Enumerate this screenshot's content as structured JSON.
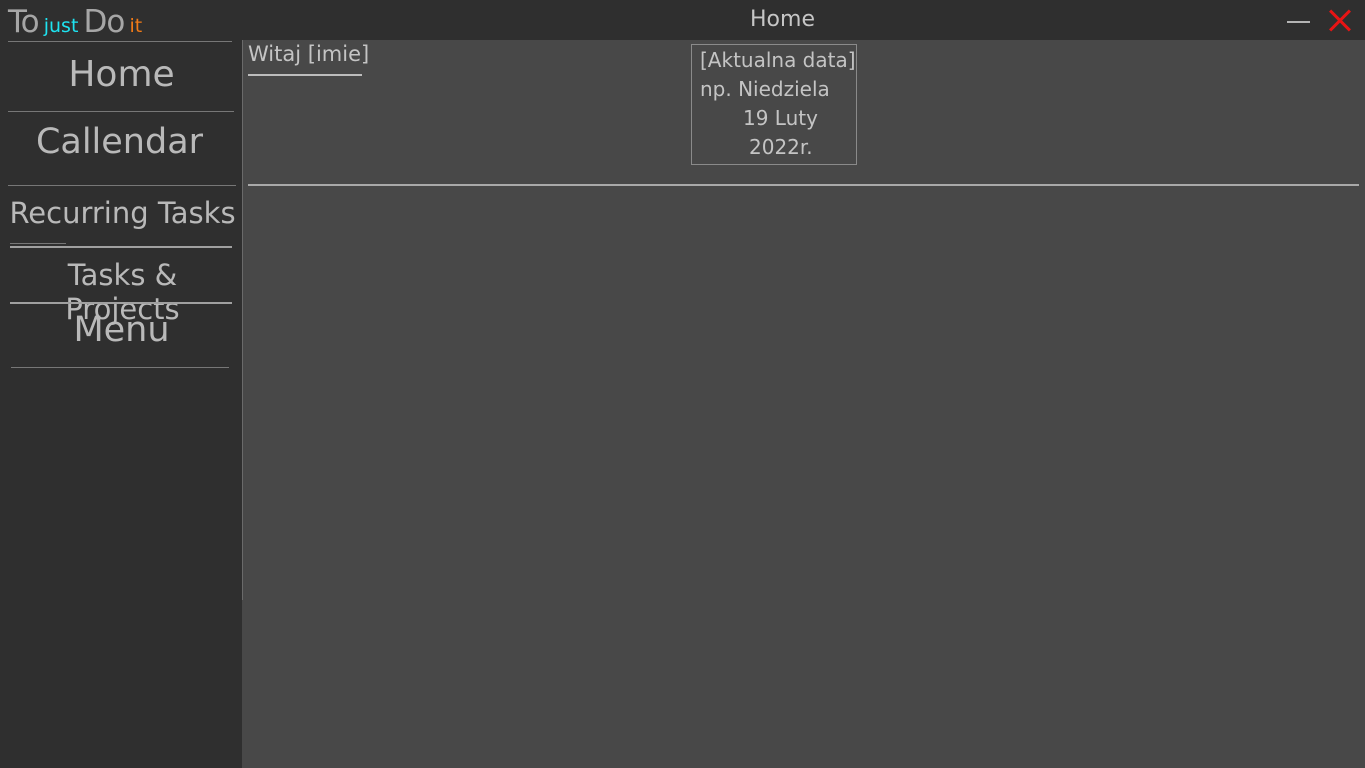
{
  "titlebar": {
    "logo": {
      "to": "To",
      "just": "just",
      "do": "Do",
      "it": "it"
    },
    "window_title": "Home",
    "minimize_icon": "minimize-icon",
    "close_icon": "close-icon"
  },
  "sidebar": {
    "items": [
      {
        "label": "Home"
      },
      {
        "label": "Callendar"
      },
      {
        "label": "Recurring Tasks"
      },
      {
        "label": "Tasks & Projects"
      },
      {
        "label": "Menu"
      }
    ]
  },
  "main": {
    "greeting": "Witaj [imie]",
    "date": {
      "line1": "[Aktualna data]",
      "line2": "np. Niedziela",
      "line3": "19 Luty",
      "line4": "2022r."
    }
  },
  "colors": {
    "background_dark": "#2f2f2f",
    "main_panel": "#484848",
    "logo_just": "#1ee3f0",
    "logo_it": "#f07a17",
    "close": "#e81414"
  }
}
